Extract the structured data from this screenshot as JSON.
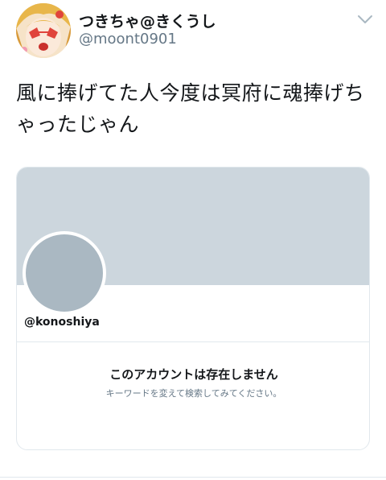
{
  "tweet": {
    "author": {
      "display_name": "つきちゃ@きくうし",
      "handle": "@moont0901"
    },
    "text": "風に捧げてた人今度は冥府に魂捧げちゃったじゃん"
  },
  "card": {
    "handle": "@konoshiya",
    "not_found_title": "このアカウントは存在しません",
    "not_found_subtitle": "キーワードを変えて検索してみてください。"
  },
  "icons": {
    "menu": "chevron-down-icon"
  },
  "colors": {
    "banner": "#ccd6dd",
    "placeholder_avatar": "#aab8c2",
    "secondary_text": "#657786",
    "border": "#e1e8ed"
  }
}
